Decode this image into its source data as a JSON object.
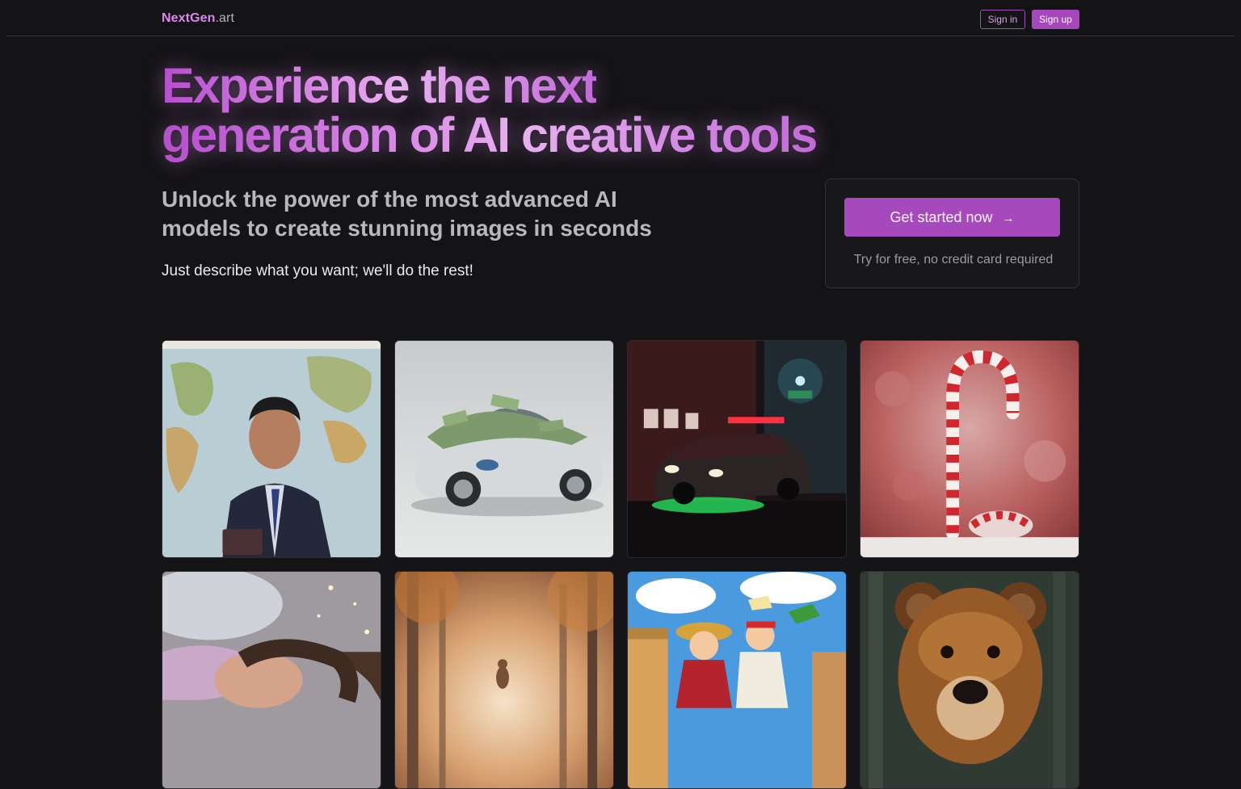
{
  "header": {
    "brand_main": "NextGen",
    "brand_suffix": ".art",
    "sign_in": "Sign in",
    "sign_up": "Sign up"
  },
  "hero": {
    "headline_line1": "Experience the next",
    "headline_line2": "generation of AI creative tools",
    "subheading": "Unlock the power of the most advanced AI models to create stunning images in seconds",
    "tagline": "Just describe what you want; we'll do the rest!"
  },
  "cta": {
    "button_label": "Get started now",
    "button_icon": "arrow-right-icon",
    "note": "Try for free, no credit card required"
  },
  "gallery": {
    "images": [
      {
        "name": "businessman-world-map-image"
      },
      {
        "name": "money-covered-car-image"
      },
      {
        "name": "police-car-alley-image"
      },
      {
        "name": "candy-cane-image"
      },
      {
        "name": "sleeping-girl-image"
      },
      {
        "name": "autumn-forest-path-image"
      },
      {
        "name": "anime-pirates-image"
      },
      {
        "name": "brown-bear-illustration-image"
      }
    ]
  },
  "colors": {
    "background": "#141316",
    "accent": "#a649bc",
    "brand_text": "#d88be8"
  }
}
